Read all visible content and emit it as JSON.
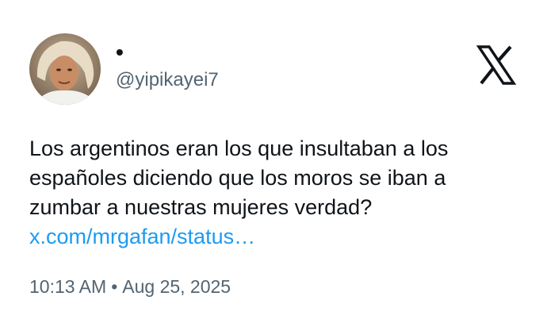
{
  "author": {
    "display_name": "•",
    "handle": "@yipikayei7"
  },
  "icons": {
    "avatar": "profile-photo",
    "logo": "x-logo-icon"
  },
  "tweet": {
    "text_lines": [
      "Los argentinos eran los que insultaban a los",
      "españoles diciendo que los moros se iban a",
      "zumbar a nuestras mujeres verdad?"
    ],
    "link": "x.com/mrgafan/status…"
  },
  "meta": {
    "time": "10:13 AM",
    "separator": "•",
    "date": "Aug 25, 2025"
  },
  "colors": {
    "text": "#0f1419",
    "secondary": "#536471",
    "link": "#1d9bf0",
    "background": "#ffffff"
  }
}
